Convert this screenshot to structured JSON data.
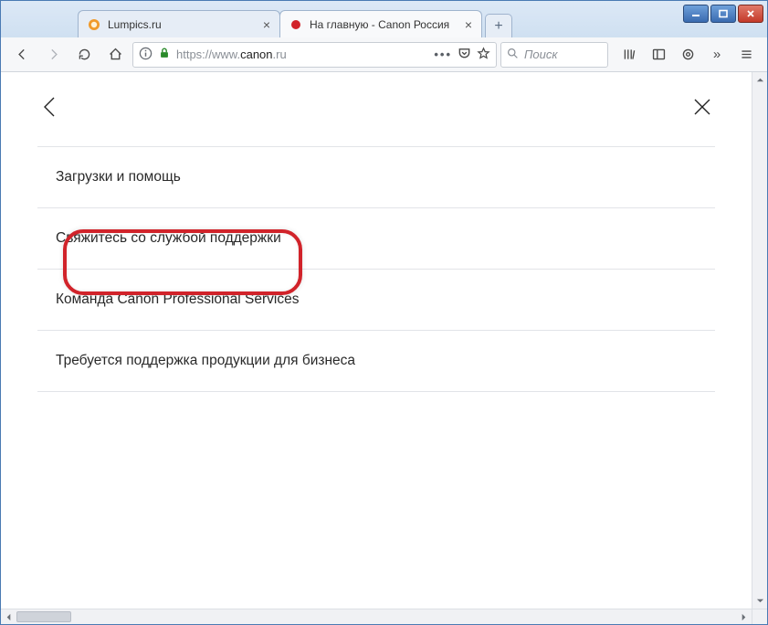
{
  "window": {
    "controls": {
      "minimize": "minimize",
      "maximize": "maximize",
      "close": "close"
    }
  },
  "tabs": [
    {
      "title": "Lumpics.ru",
      "favicon": "lumpics"
    },
    {
      "title": "На главную - Canon Россия",
      "favicon": "canon"
    }
  ],
  "newtab_label": "+",
  "nav": {
    "back": "back",
    "forward": "forward",
    "reload": "reload",
    "home": "home",
    "info_icon": "info",
    "lock_icon": "lock",
    "url_scheme": "https://",
    "url_prefix": "www.",
    "url_host": "canon",
    "url_suffix": ".ru",
    "more": "•••",
    "pocket": "pocket",
    "star": "star",
    "search_placeholder": "Поиск",
    "library": "library",
    "sidebar": "sidebar",
    "containers": "containers",
    "overflow": "»",
    "menu": "menu"
  },
  "page": {
    "back_icon": "chevron-left",
    "close_icon": "x",
    "menu_items": [
      "Загрузки и помощь",
      "Свяжитесь со службой поддержки",
      "Команда Canon Professional Services",
      "Требуется поддержка продукции для бизнеса"
    ]
  }
}
